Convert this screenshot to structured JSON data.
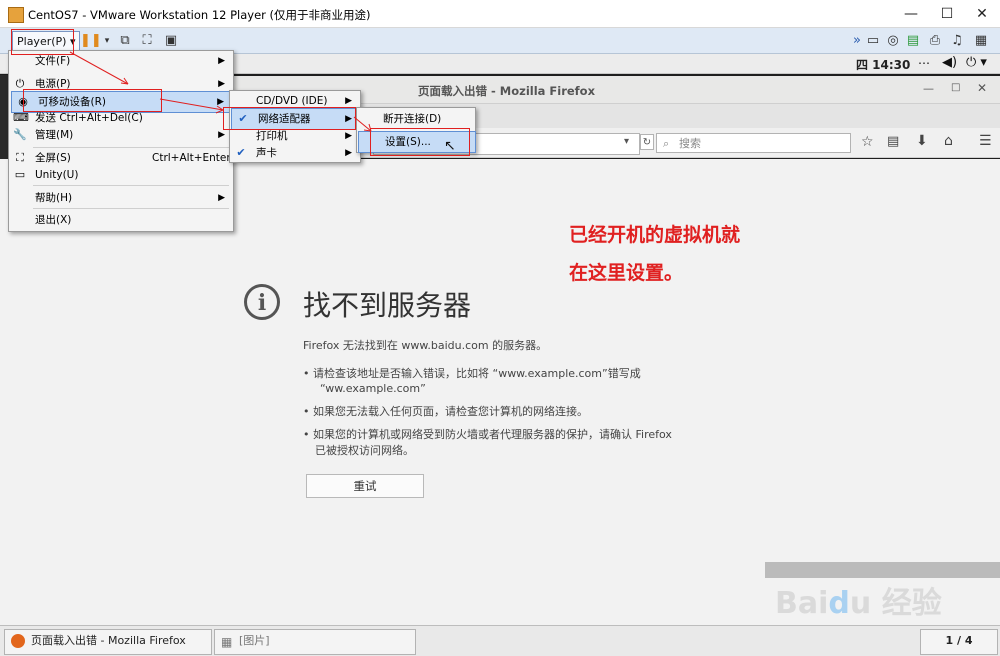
{
  "vm": {
    "window_title": "CentOS7 - VMware Workstation 12 Player (仅用于非商业用途)",
    "player_label": "Player(P)",
    "colors": {
      "accent": "#dfe9f5",
      "highlight": "#c6dcf6",
      "annotation": "#e02020"
    }
  },
  "guest": {
    "clock": "四 14:30"
  },
  "player_menu": {
    "items": [
      {
        "label": "文件(F)",
        "icon": "folder-icon",
        "submenu": true
      },
      {
        "label": "电源(P)",
        "icon": "power-icon",
        "submenu": true
      },
      {
        "label": "可移动设备(R)",
        "icon": "usb-icon",
        "submenu": true
      },
      {
        "label": "发送 Ctrl+Alt+Del(C)",
        "icon": "keyboard-icon",
        "submenu": false
      },
      {
        "label": "管理(M)",
        "icon": "wrench-icon",
        "submenu": true
      },
      {
        "label": "全屏(S)",
        "icon": "fullscreen-icon",
        "shortcut": "Ctrl+Alt+Enter"
      },
      {
        "label": "Unity(U)",
        "icon": "unity-icon"
      },
      {
        "label": "帮助(H)",
        "submenu": true
      },
      {
        "label": "退出(X)"
      }
    ]
  },
  "removable_menu": {
    "items": [
      {
        "label": "CD/DVD (IDE)",
        "checked": false
      },
      {
        "label": "网络适配器",
        "checked": true
      },
      {
        "label": "打印机",
        "checked": false
      },
      {
        "label": "声卡",
        "checked": true
      }
    ]
  },
  "network_menu": {
    "items": [
      {
        "label": "断开连接(D)"
      },
      {
        "label": "设置(S)..."
      }
    ]
  },
  "firefox": {
    "window_title": "页面载入出错 - Mozilla Firefox",
    "search_placeholder": "搜索"
  },
  "error_page": {
    "heading": "找不到服务器",
    "intro": "Firefox 无法找到在 www.baidu.com 的服务器。",
    "bullet1_line1": "请检查该地址是否输入错误，比如将 “www.example.com”错写成",
    "bullet1_line2": "“ww.example.com”",
    "bullet2": "如果您无法载入任何页面，请检查您计算机的网络连接。",
    "bullet3_line1": "如果您的计算机或网络受到防火墙或者代理服务器的保护，请确认 Firefox",
    "bullet3_line2": "已被授权访问网络。",
    "retry": "重试"
  },
  "annotation": {
    "line1": "已经开机的虚拟机就",
    "line2": "在这里设置。"
  },
  "taskbar": {
    "task1": "页面载入出错 - Mozilla Firefox",
    "task2": "[图片]",
    "workspace": "1 / 4"
  }
}
